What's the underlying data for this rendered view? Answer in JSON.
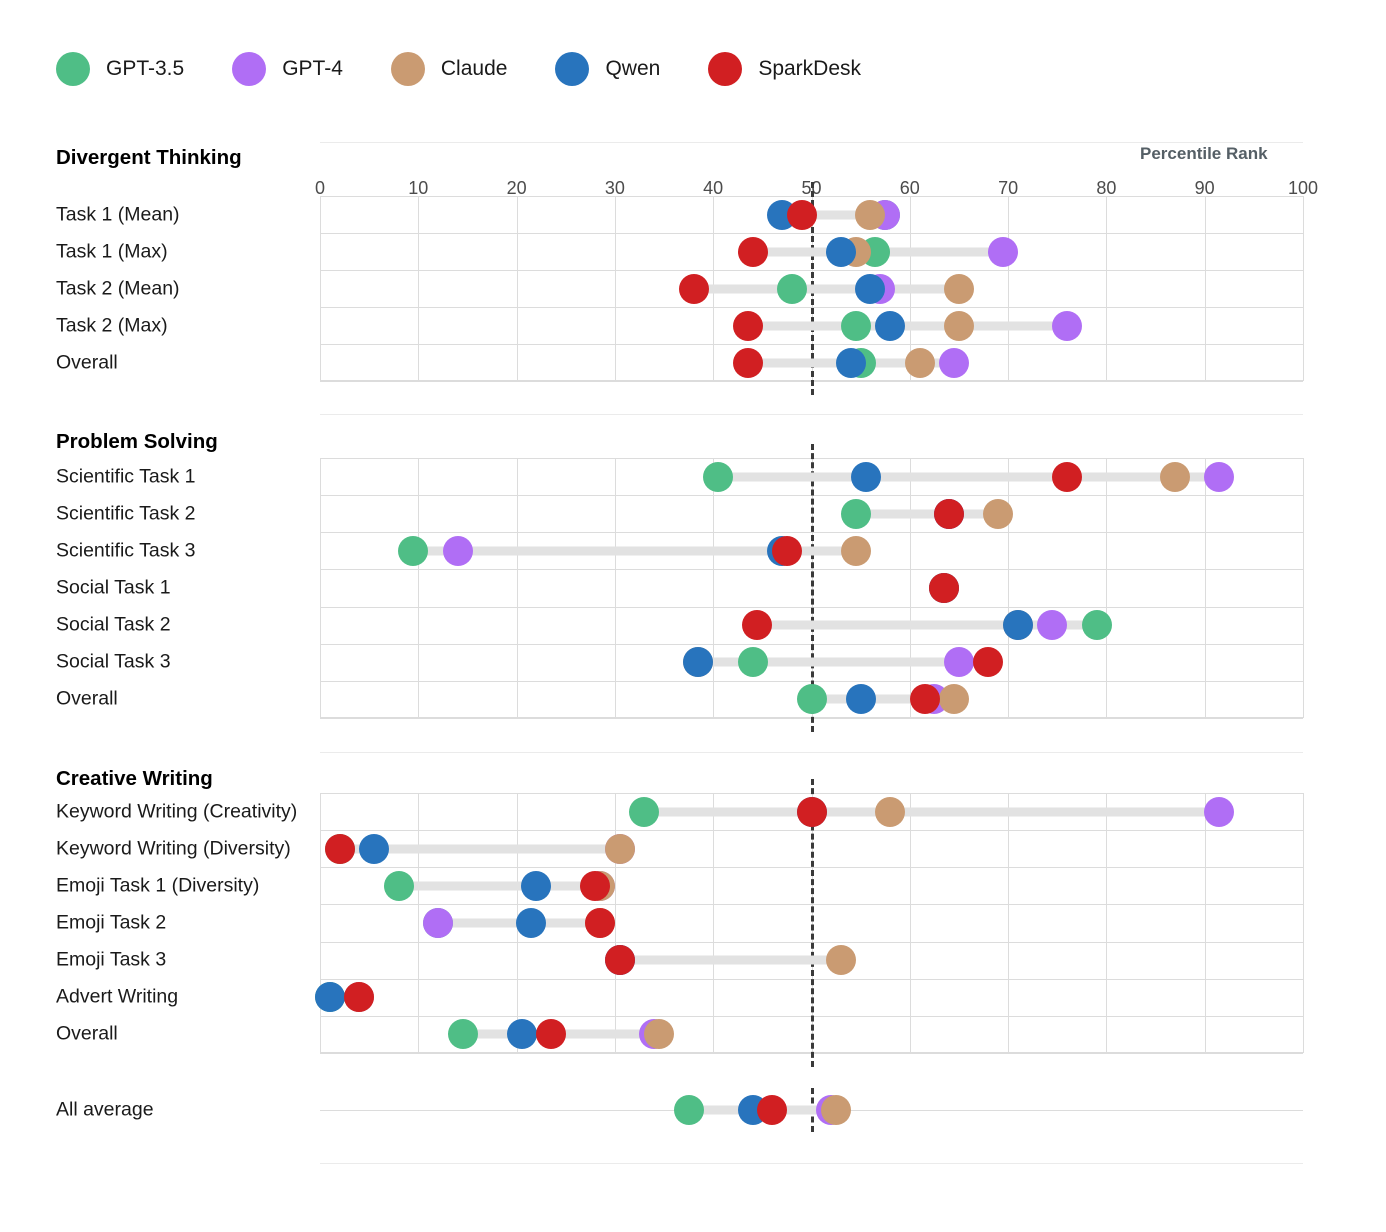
{
  "legend": {
    "items": [
      {
        "label": "GPT-3.5",
        "color": "#4fbe86"
      },
      {
        "label": "GPT-4",
        "color": "#b06ef5"
      },
      {
        "label": "Claude",
        "color": "#ca9b72"
      },
      {
        "label": "Qwen",
        "color": "#2874bd"
      },
      {
        "label": "SparkDesk",
        "color": "#d11f22"
      }
    ]
  },
  "axis": {
    "title": "Percentile Rank",
    "ticks": [
      0,
      10,
      20,
      30,
      40,
      50,
      60,
      70,
      80,
      90,
      100
    ],
    "reference_line": 50
  },
  "chart_data": {
    "type": "scatter",
    "title": "",
    "xlabel": "Percentile Rank",
    "ylabel": "",
    "xlim": [
      0,
      100
    ],
    "grid": true,
    "legend_position": "top-left",
    "reference_line": 50,
    "series_names": [
      "GPT-3.5",
      "GPT-4",
      "Claude",
      "Qwen",
      "SparkDesk"
    ],
    "series_colors": [
      "#4fbe86",
      "#b06ef5",
      "#ca9b72",
      "#2874bd",
      "#d11f22"
    ],
    "groups": [
      {
        "name": "Divergent Thinking",
        "rows": [
          {
            "label": "Task 1 (Mean)",
            "values": {
              "GPT-3.5": 57.5,
              "GPT-4": 57.5,
              "Claude": 56.0,
              "Qwen": 47.0,
              "SparkDesk": 49.0
            }
          },
          {
            "label": "Task 1 (Max)",
            "values": {
              "GPT-3.5": 56.5,
              "GPT-4": 69.5,
              "Claude": 54.5,
              "Qwen": 53.0,
              "SparkDesk": 44.0
            }
          },
          {
            "label": "Task 2 (Mean)",
            "values": {
              "GPT-3.5": 48.0,
              "GPT-4": 57.0,
              "Claude": 65.0,
              "Qwen": 56.0,
              "SparkDesk": 38.0
            }
          },
          {
            "label": "Task 2 (Max)",
            "values": {
              "GPT-3.5": 54.5,
              "GPT-4": 76.0,
              "Claude": 65.0,
              "Qwen": 58.0,
              "SparkDesk": 43.5
            }
          },
          {
            "label": "Overall",
            "values": {
              "GPT-3.5": 55.0,
              "GPT-4": 64.5,
              "Claude": 61.0,
              "Qwen": 54.0,
              "SparkDesk": 43.5
            }
          }
        ]
      },
      {
        "name": "Problem Solving",
        "rows": [
          {
            "label": "Scientific Task 1",
            "values": {
              "GPT-3.5": 40.5,
              "GPT-4": 91.5,
              "Claude": 87.0,
              "Qwen": 55.5,
              "SparkDesk": 76.0
            }
          },
          {
            "label": "Scientific Task 2",
            "values": {
              "GPT-3.5": 54.5,
              "GPT-4": 64.0,
              "Claude": 69.0,
              "Qwen": 64.0,
              "SparkDesk": 64.0
            }
          },
          {
            "label": "Scientific Task 3",
            "values": {
              "GPT-3.5": 9.5,
              "GPT-4": 14.0,
              "Claude": 54.5,
              "Qwen": 47.0,
              "SparkDesk": 47.5
            }
          },
          {
            "label": "Social Task 1",
            "values": {
              "GPT-3.5": 63.5,
              "GPT-4": 63.5,
              "Claude": 63.5,
              "Qwen": 63.5,
              "SparkDesk": 63.5
            }
          },
          {
            "label": "Social Task 2",
            "values": {
              "GPT-3.5": 79.0,
              "GPT-4": 74.5,
              "Claude": 71.0,
              "Qwen": 71.0,
              "SparkDesk": 44.5
            }
          },
          {
            "label": "Social Task 3",
            "values": {
              "GPT-3.5": 44.0,
              "GPT-4": 65.0,
              "Claude": 38.5,
              "Qwen": 38.5,
              "SparkDesk": 68.0
            }
          },
          {
            "label": "Overall",
            "values": {
              "GPT-3.5": 50.0,
              "GPT-4": 62.5,
              "Claude": 64.5,
              "Qwen": 55.0,
              "SparkDesk": 61.5
            }
          }
        ]
      },
      {
        "name": "Creative Writing",
        "rows": [
          {
            "label": "Keyword Writing (Creativity)",
            "values": {
              "GPT-3.5": 33.0,
              "GPT-4": 91.5,
              "Claude": 58.0,
              "Qwen": 50.0,
              "SparkDesk": 50.0
            }
          },
          {
            "label": "Keyword Writing (Diversity)",
            "values": {
              "GPT-3.5": 2.0,
              "GPT-4": 30.5,
              "Claude": 30.5,
              "Qwen": 5.5,
              "SparkDesk": 2.0
            }
          },
          {
            "label": "Emoji Task 1 (Diversity)",
            "values": {
              "GPT-3.5": 8.0,
              "GPT-4": 28.5,
              "Claude": 28.5,
              "Qwen": 22.0,
              "SparkDesk": 28.0
            }
          },
          {
            "label": "Emoji Task 2",
            "values": {
              "GPT-3.5": 12.0,
              "GPT-4": 12.0,
              "Claude": 28.5,
              "Qwen": 21.5,
              "SparkDesk": 28.5
            }
          },
          {
            "label": "Emoji Task 3",
            "values": {
              "GPT-3.5": 30.5,
              "GPT-4": 30.5,
              "Claude": 53.0,
              "Qwen": 30.5,
              "SparkDesk": 30.5
            }
          },
          {
            "label": "Advert Writing",
            "values": {
              "GPT-3.5": 1.0,
              "GPT-4": 4.0,
              "Claude": 4.0,
              "Qwen": 1.0,
              "SparkDesk": 4.0
            }
          },
          {
            "label": "Overall",
            "values": {
              "GPT-3.5": 14.5,
              "GPT-4": 34.0,
              "Claude": 34.5,
              "Qwen": 20.5,
              "SparkDesk": 23.5
            }
          }
        ]
      },
      {
        "name": "",
        "rows": [
          {
            "label": "All average",
            "values": {
              "GPT-3.5": 37.5,
              "GPT-4": 52.0,
              "Claude": 52.5,
              "Qwen": 44.0,
              "SparkDesk": 46.0
            }
          }
        ]
      }
    ]
  }
}
